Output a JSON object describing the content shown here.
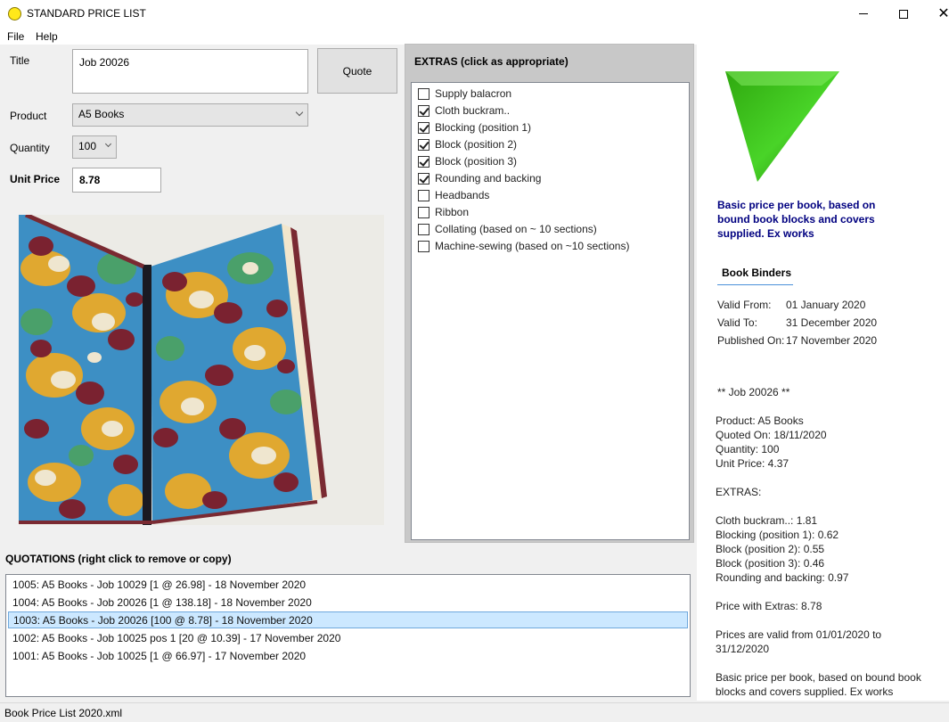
{
  "window": {
    "title": "STANDARD PRICE LIST"
  },
  "menu": {
    "items": [
      "File",
      "Help"
    ]
  },
  "form": {
    "title_label": "Title",
    "title_value": "Job 20026",
    "quote_button": "Quote",
    "product_label": "Product",
    "product_value": "A5 Books",
    "quantity_label": "Quantity",
    "quantity_value": "100",
    "unit_price_label": "Unit Price",
    "unit_price_value": "8.78"
  },
  "extras": {
    "title": "EXTRAS (click as appropriate)",
    "items": [
      {
        "label": "Supply balacron",
        "checked": false
      },
      {
        "label": "Cloth buckram..",
        "checked": true
      },
      {
        "label": "Blocking (position 1)",
        "checked": true
      },
      {
        "label": "Block (position 2)",
        "checked": true
      },
      {
        "label": "Block (position 3)",
        "checked": true
      },
      {
        "label": "Rounding and backing",
        "checked": true
      },
      {
        "label": "Headbands",
        "checked": false
      },
      {
        "label": "Ribbon",
        "checked": false
      },
      {
        "label": "Collating (based on ~ 10 sections)",
        "checked": false
      },
      {
        "label": "Machine-sewing (based on ~10 sections)",
        "checked": false
      }
    ]
  },
  "info": {
    "basic_note": "Basic price per book, based on bound book blocks and covers supplied. Ex works",
    "company": "Book Binders",
    "valid_from_label": "Valid From:",
    "valid_from": "01 January 2020",
    "valid_to_label": "Valid To:",
    "valid_to": "31 December 2020",
    "published_label": "Published On:",
    "published": "17 November 2020"
  },
  "quote_detail": {
    "header": "** Job 20026 **",
    "product": "Product: A5 Books",
    "quoted_on": "Quoted On: 18/11/2020",
    "quantity": "Quantity: 100",
    "unit_price": "Unit Price: 4.37",
    "extras_header": "EXTRAS:",
    "extra_1": "Cloth buckram..: 1.81",
    "extra_2": "Blocking (position 1): 0.62",
    "extra_3": "Block (position 2): 0.55",
    "extra_4": "Block (position 3): 0.46",
    "extra_5": "Rounding and backing: 0.97",
    "price_with_extras": "Price with Extras: 8.78",
    "validity_1": "Prices are valid from 01/01/2020 to",
    "validity_2": "31/12/2020",
    "note_1": "Basic price per book, based on bound book",
    "note_2": "blocks and covers supplied. Ex works"
  },
  "quotations": {
    "title": "QUOTATIONS (right click to remove or copy)",
    "rows": [
      "1005: A5 Books - Job 10029 [1 @ 26.98] - 18 November 2020",
      "1004: A5 Books - Job 20026 [1 @ 138.18] - 18 November 2020",
      "1003: A5 Books - Job 20026 [100 @ 8.78] - 18 November 2020",
      "1002: A5 Books - Job 10025 pos 1 [20 @ 10.39] - 17 November 2020",
      "1001: A5 Books - Job 10025 [1 @ 66.97] - 17 November 2020"
    ],
    "selected_index": 2
  },
  "status": {
    "text": "Book Price List 2020.xml"
  },
  "colors": {
    "accent_blue": "#000080",
    "selection": "#cce8ff",
    "triangle_green": "#3fbf1f"
  }
}
